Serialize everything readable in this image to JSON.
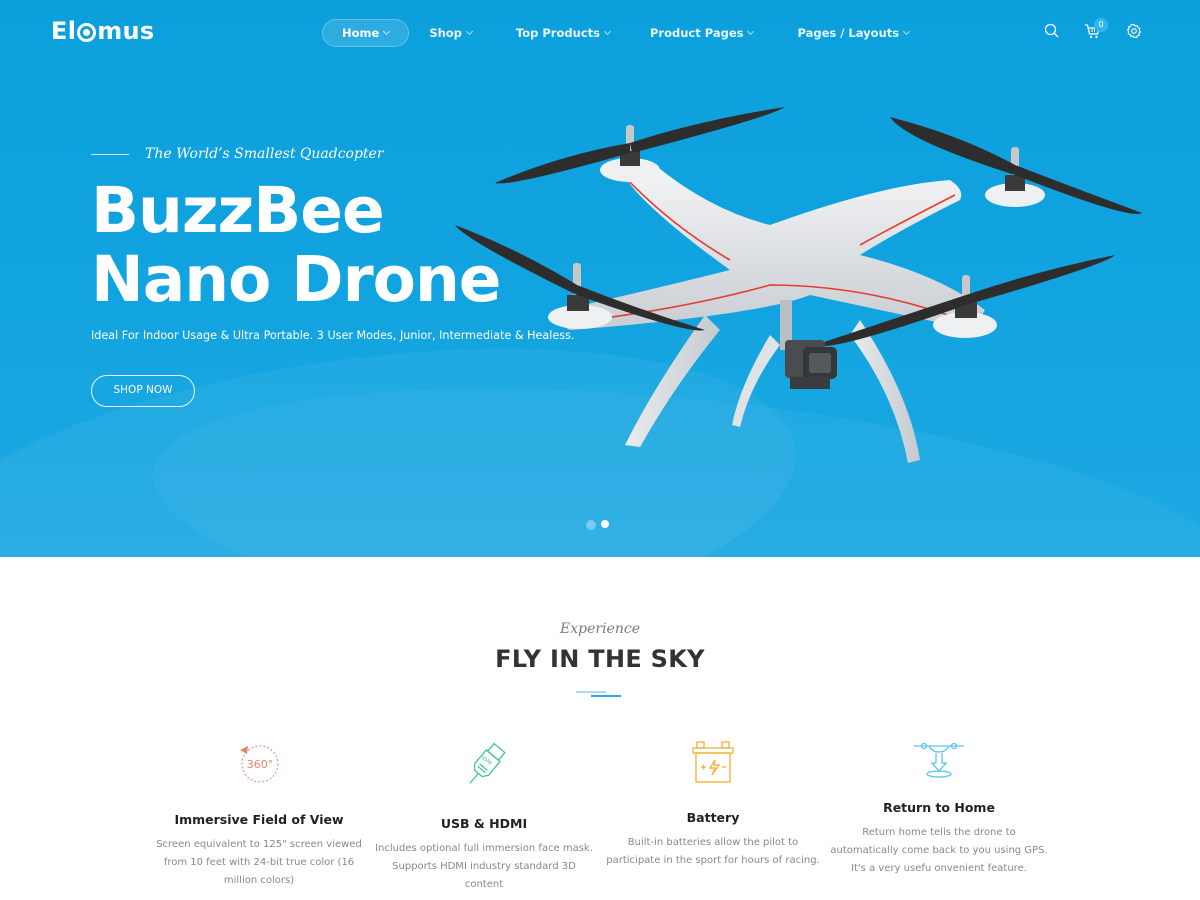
{
  "header": {
    "logo_text": "Elomus",
    "logo_prefix": "El",
    "logo_suffix": "mus",
    "nav": [
      {
        "label": "Home",
        "active": true
      },
      {
        "label": "Shop"
      },
      {
        "label": "Top Products"
      },
      {
        "label": "Product Pages"
      },
      {
        "label": "Pages / Layouts"
      }
    ],
    "icons": [
      "search-icon",
      "cart-icon",
      "gear-icon"
    ],
    "cart_count": "0"
  },
  "hero": {
    "tagline": "The World’s Smallest Quadcopter",
    "title_line1": "BuzzBee",
    "title_line2": "Nano Drone",
    "subtitle": "Ideal For Indoor Usage & Ultra Portable. 3 User Modes, Junior, Intermediate & Healess.",
    "cta_label": "SHOP NOW",
    "slides": 2,
    "active_slide": 2,
    "colors": {
      "background": "#0b9fdc",
      "accent": "#2aa9e0"
    }
  },
  "section": {
    "kicker": "Experience",
    "title": "FLY IN THE SKY"
  },
  "features": [
    {
      "icon": "360-view-icon",
      "icon_text": "360°",
      "title": "Immersive Field of View",
      "description": "Screen equivalent to 125\" screen viewed from 10 feet with 24-bit true color (16 million colors)",
      "color": "#e8836b"
    },
    {
      "icon": "hdmi-cable-icon",
      "icon_text": "HDMI",
      "title": "USB & HDMI",
      "description": "Includes optional full immersion face mask. Supports HDMI industry standard 3D content",
      "color": "#3ec98a"
    },
    {
      "icon": "battery-icon",
      "title": "Battery",
      "description": "Built-in batteries allow the pilot to participate in the sport for hours of racing.",
      "color": "#f2b640"
    },
    {
      "icon": "drone-return-home-icon",
      "title": "Return to Home",
      "description": "Return home tells the drone to automatically come back to you using GPS. It's a very usefu onvenient feature.",
      "color": "#5cc3ef"
    }
  ]
}
